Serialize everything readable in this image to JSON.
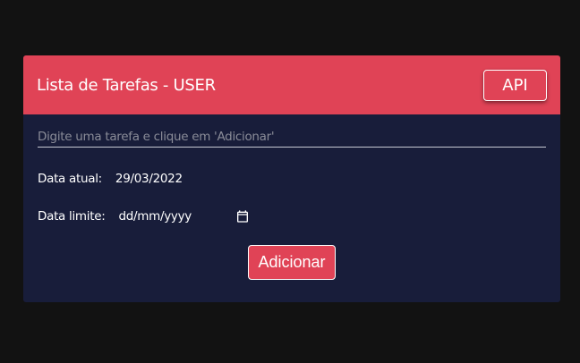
{
  "header": {
    "title": "Lista de Tarefas - USER",
    "api_label": "API"
  },
  "form": {
    "task_placeholder": "Digite uma tarefa e clique em 'Adicionar'",
    "task_value": "",
    "current_date_label": "Data atual:",
    "current_date_value": "29/03/2022",
    "limit_date_label": "Data limite:",
    "limit_date_placeholder": "dd/mm/yyyy",
    "add_label": "Adicionar"
  },
  "icons": {
    "calendar": "calendar-icon"
  },
  "colors": {
    "page_background": "#121212",
    "card_background": "#181d3a",
    "accent": "#e04356",
    "text": "#ffffff"
  }
}
